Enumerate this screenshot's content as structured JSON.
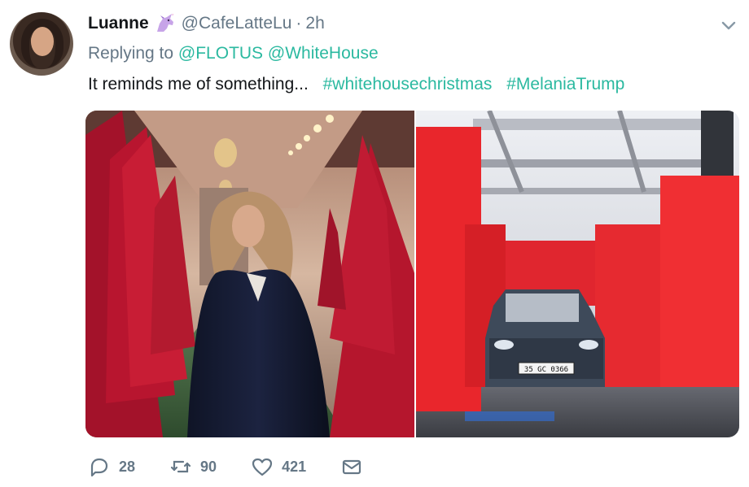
{
  "tweet": {
    "author": {
      "display_name": "Luanne",
      "handle": "@CafeLatteLu",
      "time": "2h",
      "name_emoji": "unicorn-icon"
    },
    "reply": {
      "prefix": "Replying to",
      "mentions": [
        "@FLOTUS",
        "@WhiteHouse"
      ]
    },
    "text": "It reminds me of something...",
    "hashtags": [
      "#whitehousechristmas",
      "#MelaniaTrump"
    ],
    "media": {
      "photos": [
        {
          "subject": "red-trees-hallway-photo"
        },
        {
          "subject": "car-wash-photo",
          "plate_text": "35 GC 0366"
        }
      ]
    },
    "actions": {
      "replies": "28",
      "retweets": "90",
      "likes": "421"
    },
    "colors": {
      "accent": "#2bb9a0",
      "muted": "#657786",
      "text": "#14171a"
    }
  }
}
